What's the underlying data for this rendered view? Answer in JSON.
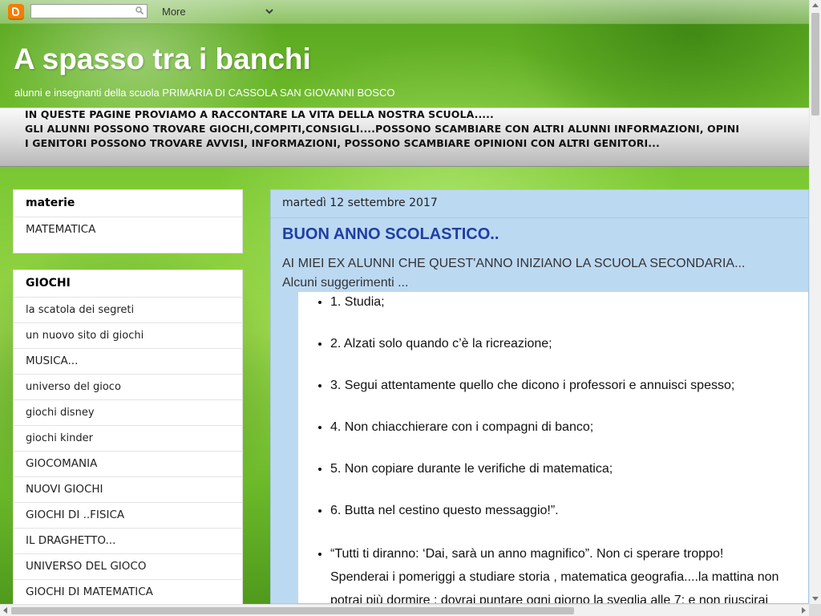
{
  "navbar": {
    "logo_icon": "blogger-icon",
    "search_placeholder": "",
    "more_label": "More"
  },
  "header": {
    "title": "A spasso tra i banchi",
    "description": "alunni e insegnanti della scuola PRIMARIA DI CASSOLA SAN GIOVANNI BOSCO"
  },
  "banner": {
    "lines": [
      "IN QUESTE PAGINE PROVIAMO A RACCONTARE LA VITA DELLA NOSTRA SCUOLA.....",
      "GLI ALUNNI POSSONO TROVARE GIOCHI,COMPITI,CONSIGLI....POSSONO SCAMBIARE CON ALTRI ALUNNI INFORMAZIONI, OPINI",
      "I GENITORI POSSONO TROVARE AVVISI, INFORMAZIONI, POSSONO SCAMBIARE OPINIONI CON ALTRI GENITORI..."
    ]
  },
  "sidebar": {
    "materie": {
      "title": "materie",
      "links": [
        "MATEMATICA"
      ]
    },
    "giochi": {
      "title": "GIOCHI",
      "links": [
        "la scatola dei segreti",
        "un nuovo sito di giochi",
        "MUSICA...",
        "universo del gioco",
        "giochi disney",
        "giochi kinder",
        "GIOCOMANIA",
        "NUOVI GIOCHI",
        "GIOCHI DI ..FISICA",
        "IL DRAGHETTO...",
        "UNIVERSO DEL GIOCO",
        "GIOCHI DI MATEMATICA"
      ]
    }
  },
  "post": {
    "date": "martedì 12 settembre 2017",
    "title": "BUON ANNO SCOLASTICO..",
    "intro_line1": "AI MIEI EX  ALUNNI CHE QUEST'ANNO INIZIANO LA SCUOLA SECONDARIA...",
    "intro_line2": "Alcuni suggerimenti ...",
    "items": [
      "1. Studia;",
      "2. Alzati solo quando c’è la ricreazione;",
      "3. Segui attentamente quello che dicono i professori e annuisci spesso;",
      "4. Non chiacchierare con i compagni di banco;",
      " 5. Non copiare durante le verifiche di matematica;",
      "6. Butta nel cestino questo messaggio!”.",
      "“Tutti ti diranno: ‘Dai, sarà un anno magnifico”. Non ci sperare troppo! Spenderai i pomeriggi a studiare storia , matematica  geografia....la mattina non potrai più dormire : dovrai puntare ogni giorno la sveglia alle 7: e non riuscirai mai ad aver"
    ]
  },
  "colors": {
    "title_link": "#1f3fa3",
    "post_background": "#bcd9f2",
    "logo_orange": "#f57d00"
  }
}
